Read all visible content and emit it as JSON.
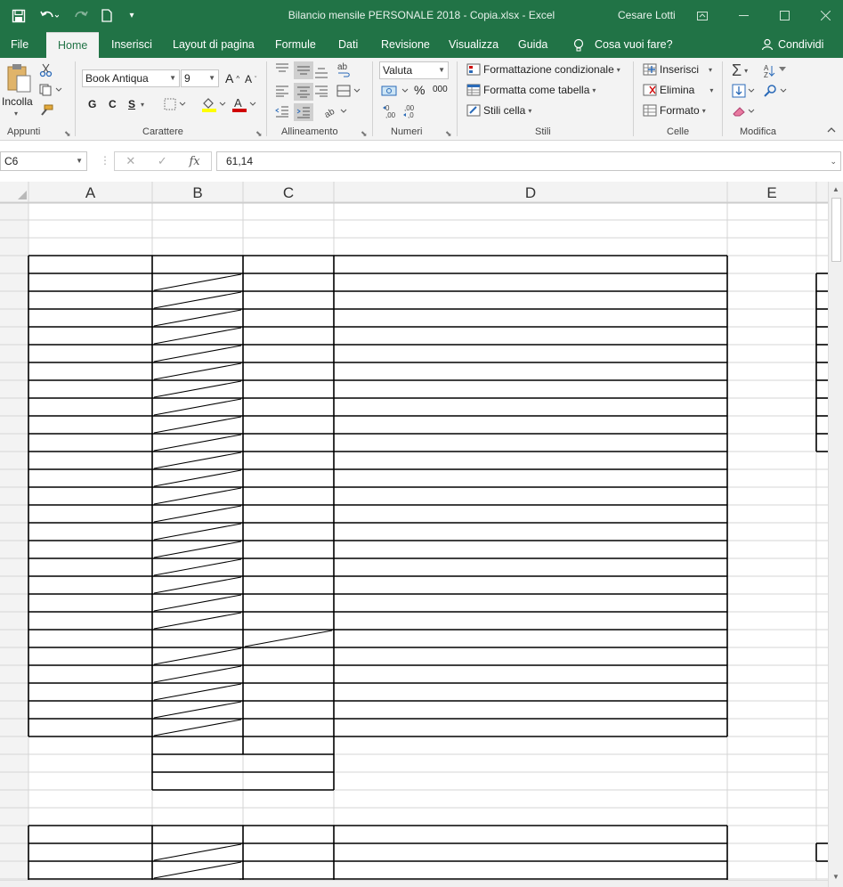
{
  "app": {
    "title": "Bilancio mensile PERSONALE 2018 - Copia.xlsx  -  Excel",
    "user": "Cesare Lotti"
  },
  "quick_access": {
    "save_icon": "save-icon",
    "undo_icon": "undo-icon",
    "redo_icon": "redo-icon",
    "new_icon": "new-document-icon",
    "customize_icon": "customize-icon"
  },
  "window": {
    "restore_icon": "restore-ribbon-icon",
    "minimize_icon": "minimize-icon",
    "maximize_icon": "maximize-icon",
    "close_icon": "close-icon"
  },
  "tabs": [
    {
      "label": "File"
    },
    {
      "label": "Home"
    },
    {
      "label": "Inserisci"
    },
    {
      "label": "Layout di pagina"
    },
    {
      "label": "Formule"
    },
    {
      "label": "Dati"
    },
    {
      "label": "Revisione"
    },
    {
      "label": "Visualizza"
    },
    {
      "label": "Guida"
    }
  ],
  "tell_me": "Cosa vuoi fare?",
  "share": "Condividi",
  "ribbon": {
    "clipboard": {
      "paste": "Incolla",
      "label": "Appunti"
    },
    "font": {
      "name": "Book Antiqua",
      "size": "9",
      "bold": "G",
      "italic": "C",
      "underline": "S",
      "label": "Carattere"
    },
    "alignment": {
      "label": "Allineamento"
    },
    "number": {
      "format": "Valuta",
      "label": "Numeri"
    },
    "styles": {
      "conditional": "Formattazione condizionale",
      "table": "Formatta come tabella",
      "cell": "Stili cella",
      "label": "Stili"
    },
    "cells": {
      "insert": "Inserisci",
      "delete": "Elimina",
      "format": "Formato",
      "label": "Celle"
    },
    "editing": {
      "label": "Modifica"
    }
  },
  "formula_bar": {
    "name_box": "C6",
    "fx": "fx",
    "value": "61,14"
  },
  "sheet": {
    "columns": [
      "A",
      "B",
      "C",
      "D",
      "E"
    ],
    "gridline_color": "#d4d4d4",
    "header_bg": "#f3f3f3"
  },
  "colors": {
    "accent": "#217346",
    "font_color_bar": "#d00000",
    "highlight_bar": "#ffff00"
  }
}
